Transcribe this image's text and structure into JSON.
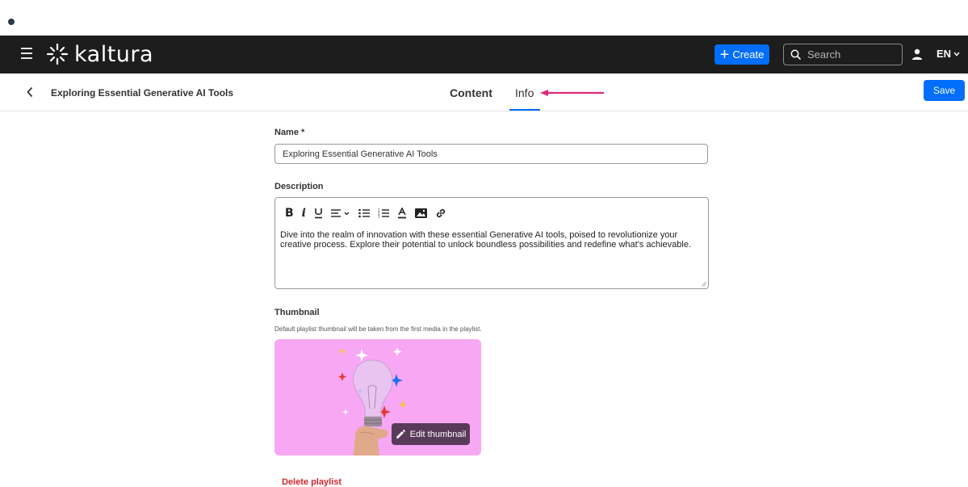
{
  "app": {
    "logo_text": "kaltura",
    "create_label": "Create",
    "search_placeholder": "Search",
    "language": "EN"
  },
  "header": {
    "title": "Exploring Essential Generative AI Tools",
    "tabs": [
      {
        "label": "Content",
        "active": false
      },
      {
        "label": "Info",
        "active": true
      }
    ],
    "save_label": "Save"
  },
  "form": {
    "name_label": "Name *",
    "name_value": "Exploring Essential Generative AI Tools",
    "description_label": "Description",
    "description_value": "Dive into the realm of innovation with these essential Generative AI tools, poised to revolutionize your creative process. Explore their potential to unlock boundless possibilities and redefine what's achievable.",
    "toolbar_icons": [
      "bold-icon",
      "italic-icon",
      "underline-icon",
      "align-icon",
      "bullet-list-icon",
      "numbered-list-icon",
      "text-color-icon",
      "image-icon",
      "link-icon"
    ],
    "thumbnail_label": "Thumbnail",
    "thumbnail_hint": "Default playlist thumbnail will be taken from the first media in the playlist.",
    "edit_thumbnail_label": "Edit thumbnail",
    "delete_label": "Delete playlist"
  },
  "colors": {
    "accent": "#006efa",
    "topbar": "#1d1d1d",
    "danger": "#d3262f",
    "annotation_arrow": "#e0287a",
    "thumbnail_bg": "#f7a7f3"
  }
}
